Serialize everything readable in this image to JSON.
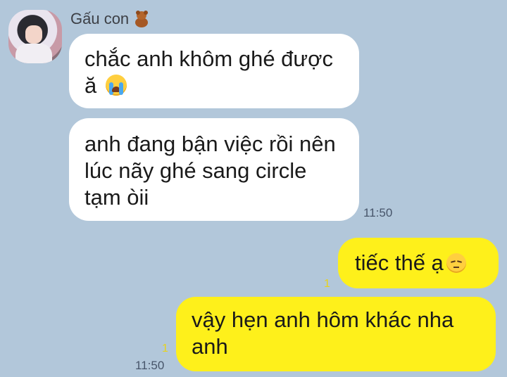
{
  "chat": {
    "sender": {
      "name": "Gấu con",
      "name_icon": "teddy-bear-icon"
    },
    "messages": [
      {
        "direction": "incoming",
        "text": "chắc anh khôm ghé được ă",
        "emoji": "loudly-crying-face-icon"
      },
      {
        "direction": "incoming",
        "text": "anh đang bận việc rồi nên lúc nãy ghé sang circle tạm òii",
        "time": "11:50"
      },
      {
        "direction": "outgoing",
        "text": "tiếc thế ạ",
        "emoji": "pensive-face-icon",
        "unread": "1"
      },
      {
        "direction": "outgoing",
        "text": "vậy hẹn anh hôm khác nha anh",
        "unread": "1",
        "time": "11:50"
      }
    ]
  },
  "colors": {
    "background": "#b2c7da",
    "incoming_bubble": "#ffffff",
    "outgoing_bubble": "#fef01b",
    "unread_count": "#e8d31a"
  }
}
